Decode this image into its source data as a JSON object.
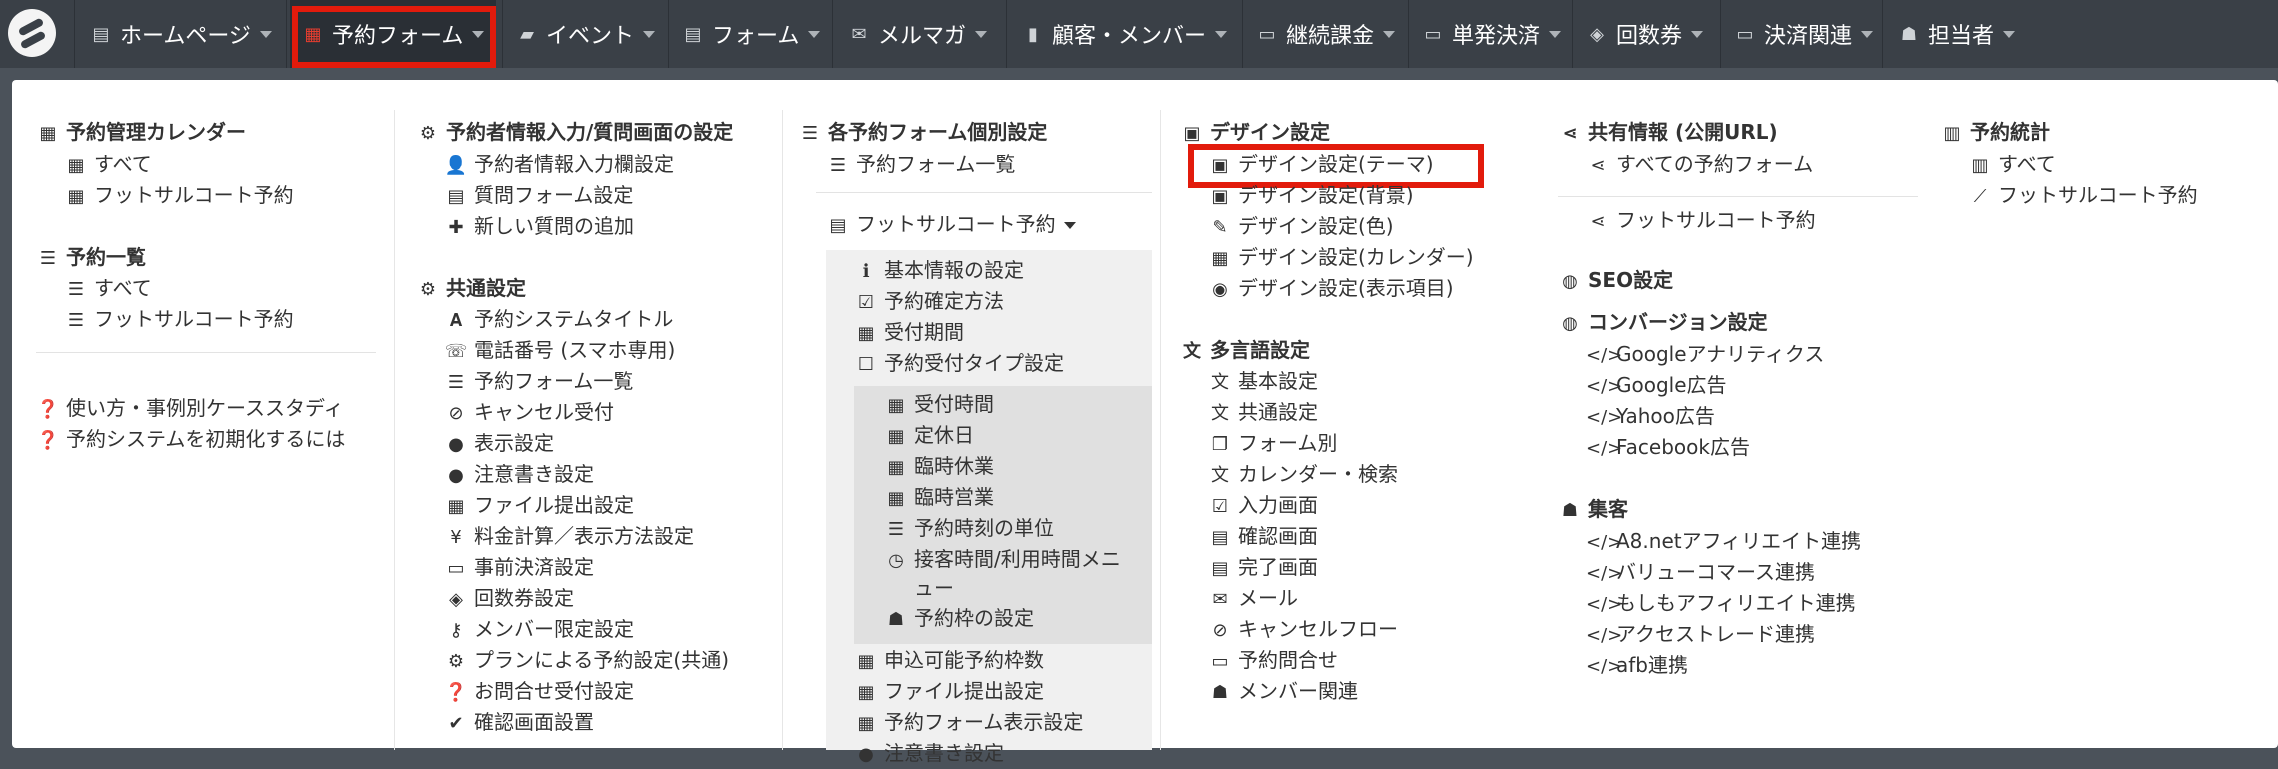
{
  "nav": {
    "items": [
      {
        "label": "ホームページ",
        "icon": "file-icon"
      },
      {
        "label": "予約フォーム",
        "icon": "calendar-icon"
      },
      {
        "label": "イベント",
        "icon": "comment-icon"
      },
      {
        "label": "フォーム",
        "icon": "list-alt-icon"
      },
      {
        "label": "メルマガ",
        "icon": "envelope-icon"
      },
      {
        "label": "顧客・メンバー",
        "icon": "book-icon"
      },
      {
        "label": "継続課金",
        "icon": "credit-card-icon"
      },
      {
        "label": "単発決済",
        "icon": "credit-card-icon"
      },
      {
        "label": "回数券",
        "icon": "ticket-icon"
      },
      {
        "label": "決済関連",
        "icon": "credit-card-icon"
      },
      {
        "label": "担当者",
        "icon": "users-icon"
      }
    ]
  },
  "menu": {
    "col1": {
      "cal_title": "予約管理カレンダー",
      "cal_all": "すべて",
      "cal_futsal": "フットサルコート予約",
      "list_title": "予約一覧",
      "list_all": "すべて",
      "list_futsal": "フットサルコート予約",
      "help1": "使い方・事例別ケーススタディ",
      "help2": "予約システムを初期化するには"
    },
    "col2": {
      "input_title": "予約者情報入力/質問画面の設定",
      "input1": "予約者情報入力欄設定",
      "input2": "質問フォーム設定",
      "input3": "新しい質問の追加",
      "common_title": "共通設定",
      "items": [
        "予約システムタイトル",
        "電話番号 (スマホ専用)",
        "予約フォーム一覧",
        "キャンセル受付",
        "表示設定",
        "注意書き設定",
        "ファイル提出設定",
        "料金計算／表示方法設定",
        "事前決済設定",
        "回数券設定",
        "メンバー限定設定",
        "プランによる予約設定(共通)",
        "お問合せ受付設定",
        "確認画面設置"
      ]
    },
    "col3": {
      "title": "各予約フォーム個別設定",
      "list": "予約フォーム一覧",
      "futsal": "フットサルコート予約",
      "sub1": [
        "基本情報の設定",
        "予約確定方法",
        "受付期間",
        "予約受付タイプ設定"
      ],
      "sub2": [
        "受付時間",
        "定休日",
        "臨時休業",
        "臨時営業",
        "予約時刻の単位",
        "接客時間/利用時間メニ",
        "ュー",
        "予約枠の設定"
      ],
      "sub3": [
        "申込可能予約枠数",
        "ファイル提出設定",
        "予約フォーム表示設定",
        "注意書き設定"
      ]
    },
    "col4": {
      "design_title": "デザイン設定",
      "design": [
        "デザイン設定(テーマ)",
        "デザイン設定(背景)",
        "デザイン設定(色)",
        "デザイン設定(カレンダー)",
        "デザイン設定(表示項目)"
      ],
      "lang_title": "多言語設定",
      "lang": [
        "基本設定",
        "共通設定",
        "フォーム別",
        "カレンダー・検索",
        "入力画面",
        "確認画面",
        "完了画面",
        "メール",
        "キャンセルフロー",
        "予約問合せ",
        "メンバー関連"
      ]
    },
    "col5": {
      "share_title": "共有情報 (公開URL)",
      "share_all": "すべての予約フォーム",
      "share_futsal": "フットサルコート予約",
      "seo_title": "SEO設定",
      "conv_title": "コンバージョン設定",
      "conv": [
        "Googleアナリティクス",
        "Google広告",
        "Yahoo広告",
        "Facebook広告"
      ],
      "attract_title": "集客",
      "attract": [
        "A8.netアフィリエイト連携",
        "バリューコマース連携",
        "もしもアフィリエイト連携",
        "アクセストレード連携",
        "afb連携"
      ]
    },
    "col6": {
      "title": "予約統計",
      "all": "すべて",
      "futsal": "フットサルコート予約"
    }
  }
}
